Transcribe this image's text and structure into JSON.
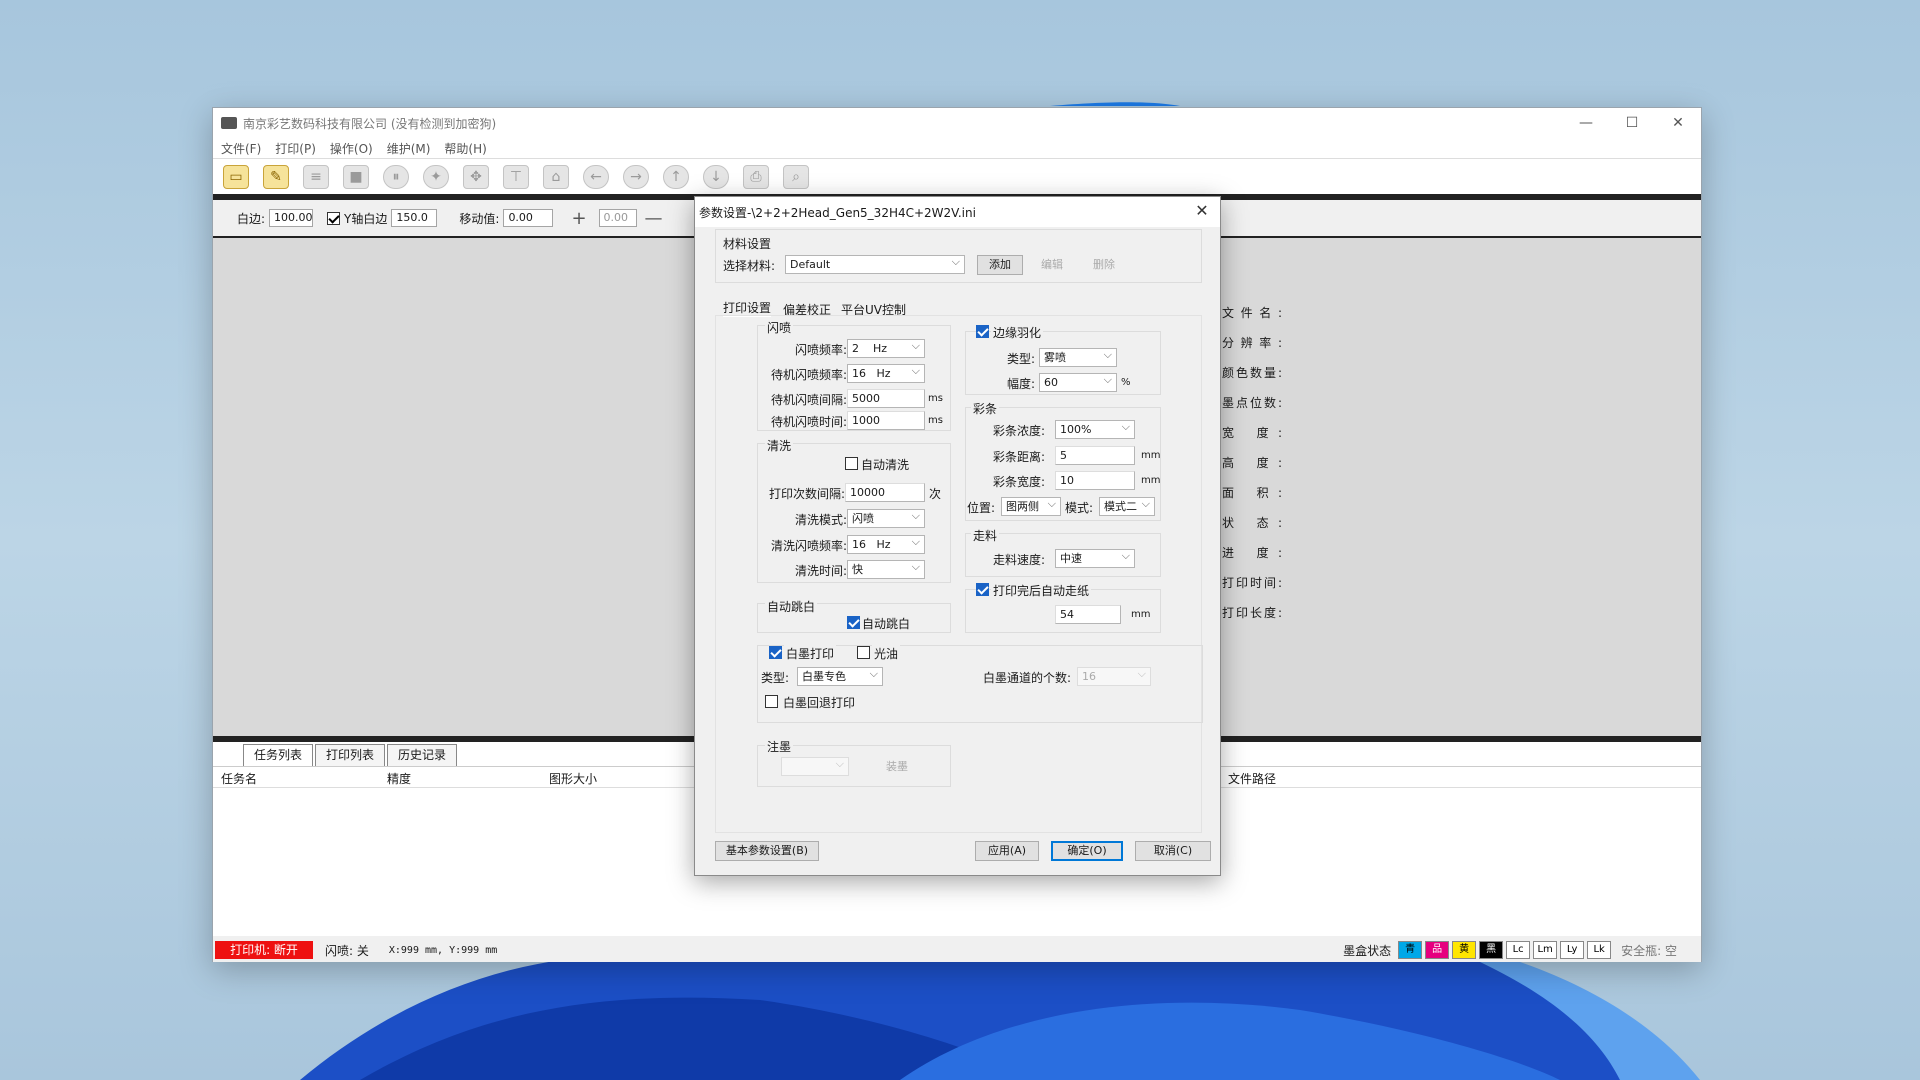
{
  "window": {
    "title": "南京彩艺数码科技有限公司 (没有检测到加密狗)"
  },
  "menu": [
    "文件(F)",
    "打印(P)",
    "操作(O)",
    "维护(M)",
    "帮助(H)"
  ],
  "toolbar": [
    "open-folder-icon",
    "load-image-icon",
    "print-queue-icon",
    "stop-icon",
    "pause-icon",
    "gear-icon",
    "move-icon",
    "measure-icon",
    "home-icon",
    "left-arrow-icon",
    "right-arrow-icon",
    "up-arrow-icon",
    "down-arrow-icon",
    "printer-icon",
    "zoom-icon"
  ],
  "params": {
    "margin_label": "白边:",
    "margin_value": "100.00",
    "y_margin_label": "Y轴白边",
    "y_margin_value": "150.0",
    "move_label": "移动值:",
    "move_value": "0.00",
    "step_value": "0.00"
  },
  "info_labels": [
    "文件名:",
    "分辨率:",
    "颜色数量:",
    "墨点位数:",
    "宽 度:",
    "高 度:",
    "面 积:",
    "状 态:",
    "进 度:",
    "打印时间:",
    "打印长度:"
  ],
  "bottom_tabs": [
    "任务列表",
    "打印列表",
    "历史记录"
  ],
  "list_headers": [
    "任务名",
    "精度",
    "图形大小",
    "文件路径"
  ],
  "status": {
    "printer": "打印机: 断开",
    "flash": "闪喷: 关",
    "coords": "X:999 mm, Y:999 mm",
    "ink_label": "墨盒状态",
    "inks": [
      {
        "label": "青",
        "color": "#00a8e8"
      },
      {
        "label": "品",
        "color": "#e6007e"
      },
      {
        "label": "黄",
        "color": "#ffe600"
      },
      {
        "label": "黑",
        "color": "#000000"
      },
      {
        "label": "Lc",
        "color": "#ffffff"
      },
      {
        "label": "Lm",
        "color": "#ffffff"
      },
      {
        "label": "Ly",
        "color": "#ffffff"
      },
      {
        "label": "Lk",
        "color": "#ffffff"
      }
    ],
    "safety": "安全瓶: 空"
  },
  "dialog": {
    "title": "参数设置-\\2+2+2Head_Gen5_32H4C+2W2V.ini",
    "material": {
      "group": "材料设置",
      "select_label": "选择材料:",
      "selected": "Default",
      "add": "添加",
      "edit": "编辑",
      "delete": "删除"
    },
    "tabs": [
      "打印设置",
      "偏差校正",
      "平台UV控制"
    ],
    "flash": {
      "group": "闪喷",
      "freq_label": "闪喷频率:",
      "freq": "2",
      "freq_unit": "Hz",
      "idle_freq_label": "待机闪喷频率:",
      "idle_freq": "16",
      "idle_freq_unit": "Hz",
      "idle_interval_label": "待机闪喷间隔:",
      "idle_interval": "5000",
      "ms1": "ms",
      "idle_time_label": "待机闪喷时间:",
      "idle_time": "1000",
      "ms2": "ms"
    },
    "clean": {
      "group": "清洗",
      "auto_clean": "自动清洗",
      "count_label": "打印次数间隔:",
      "count": "10000",
      "count_unit": "次",
      "mode_label": "清洗模式:",
      "mode": "闪喷",
      "freq_label": "清洗闪喷频率:",
      "freq": "16",
      "freq_unit": "Hz",
      "time_label": "清洗时间:",
      "time": "快"
    },
    "jump": {
      "group": "自动跳白",
      "label": "自动跳白"
    },
    "white": {
      "white_print": "白墨打印",
      "varnish": "光油",
      "type_label": "类型:",
      "type": "白墨专色",
      "channels_label": "白墨通道的个数:",
      "channels": "16",
      "rollback": "白墨回退打印"
    },
    "ink": {
      "group": "注墨",
      "button": "装墨"
    },
    "feather": {
      "label": "边缘羽化",
      "type_label": "类型:",
      "type": "雾喷",
      "amp_label": "幅度:",
      "amp": "60",
      "amp_unit": "%"
    },
    "colorbar": {
      "group": "彩条",
      "density_label": "彩条浓度:",
      "density": "100%",
      "distance_label": "彩条距离:",
      "distance": "5",
      "distance_unit": "mm",
      "width_label": "彩条宽度:",
      "width": "10",
      "width_unit": "mm",
      "position_label": "位置:",
      "position": "图两侧",
      "mode_label": "模式:",
      "mode": "模式二"
    },
    "feed": {
      "group": "走料",
      "speed_label": "走料速度:",
      "speed": "中速",
      "auto_feed": "打印完后自动走纸",
      "auto_feed_value": "54",
      "auto_feed_unit": "mm"
    },
    "buttons": {
      "basic": "基本参数设置(B)",
      "apply": "应用(A)",
      "ok": "确定(O)",
      "cancel": "取消(C)"
    }
  }
}
